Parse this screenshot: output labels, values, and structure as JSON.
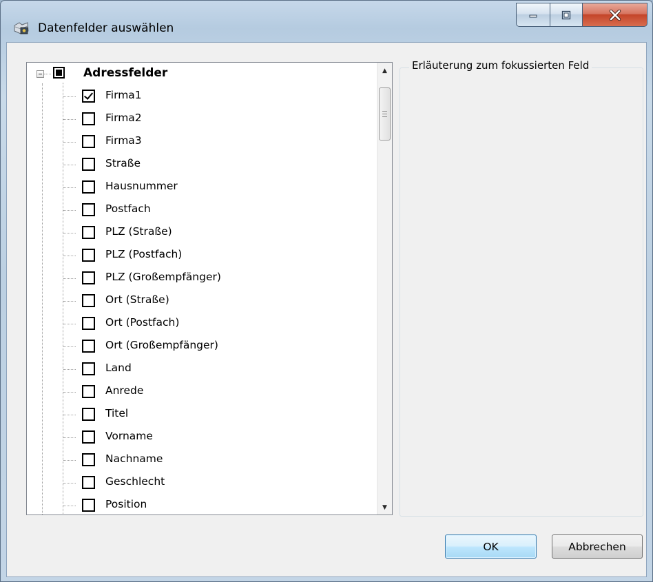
{
  "window": {
    "title": "Datenfelder auswählen",
    "icon": "folder-gear-icon",
    "controls": [
      "minimize-icon",
      "restore-icon",
      "close-icon"
    ]
  },
  "tree": {
    "root": {
      "label": "Adressfelder",
      "state": "indeterminate",
      "expanded": true
    },
    "items": [
      {
        "label": "Firma1",
        "checked": true
      },
      {
        "label": "Firma2",
        "checked": false
      },
      {
        "label": "Firma3",
        "checked": false
      },
      {
        "label": "Straße",
        "checked": false
      },
      {
        "label": "Hausnummer",
        "checked": false
      },
      {
        "label": "Postfach",
        "checked": false
      },
      {
        "label": "PLZ (Straße)",
        "checked": false
      },
      {
        "label": "PLZ (Postfach)",
        "checked": false
      },
      {
        "label": "PLZ (Großempfänger)",
        "checked": false
      },
      {
        "label": "Ort (Straße)",
        "checked": false
      },
      {
        "label": "Ort (Postfach)",
        "checked": false
      },
      {
        "label": "Ort (Großempfänger)",
        "checked": false
      },
      {
        "label": "Land",
        "checked": false
      },
      {
        "label": "Anrede",
        "checked": false
      },
      {
        "label": "Titel",
        "checked": false
      },
      {
        "label": "Vorname",
        "checked": false
      },
      {
        "label": "Nachname",
        "checked": false
      },
      {
        "label": "Geschlecht",
        "checked": false
      },
      {
        "label": "Position",
        "checked": false
      }
    ]
  },
  "description_group": {
    "legend": "Erläuterung zum fokussierten Feld"
  },
  "buttons": {
    "ok": "OK",
    "cancel": "Abbrechen"
  }
}
